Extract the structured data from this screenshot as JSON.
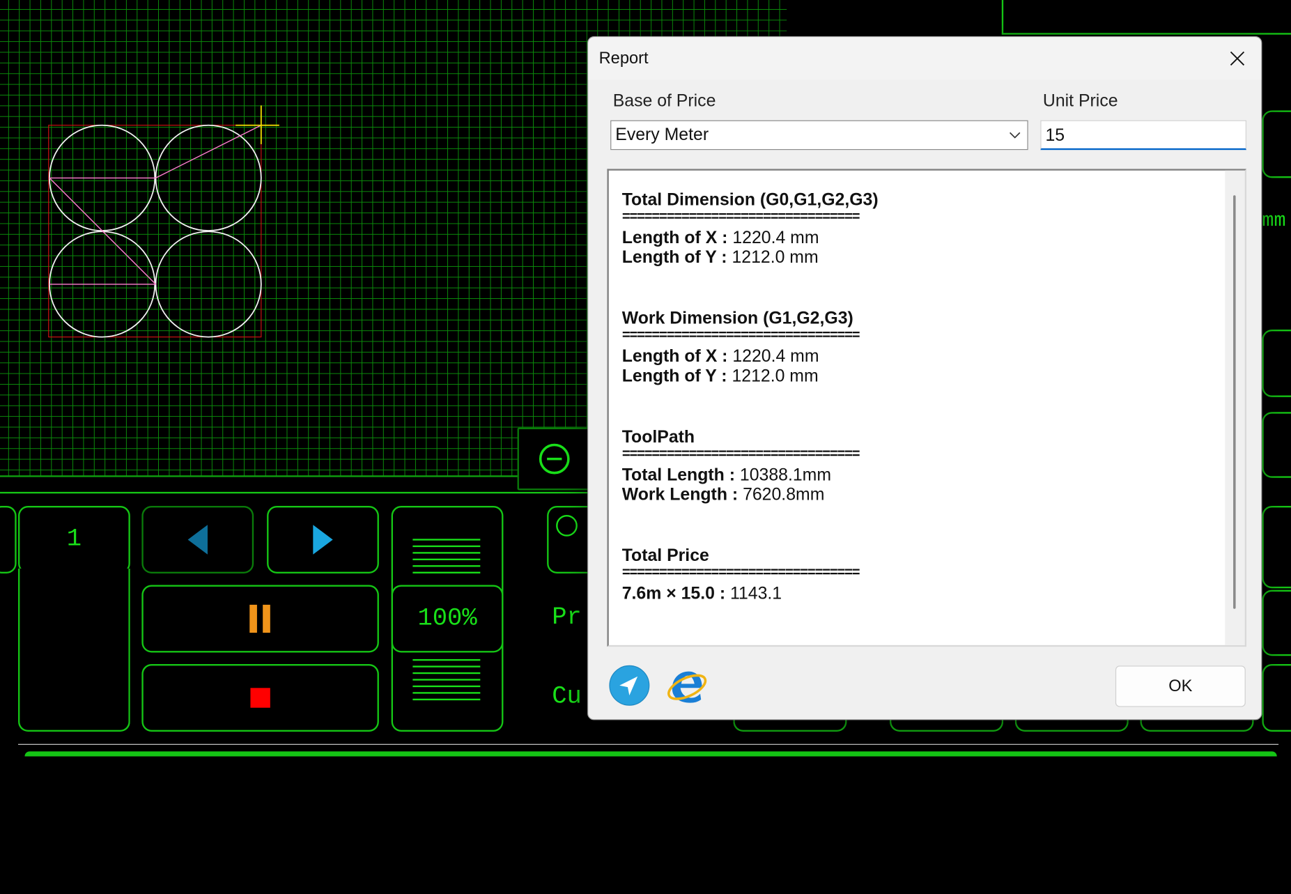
{
  "panel": {
    "counter_value": "1",
    "speed_value": "100%",
    "label_pr": "Pr",
    "label_cu": "Cu",
    "label_mm": "mm",
    "colors": {
      "accent": "#19e019",
      "nav_arrow": "#1aa7e0",
      "pause": "#f0941a",
      "stop": "#ff0000"
    }
  },
  "dialog": {
    "title": "Report",
    "base_label": "Base of Price",
    "base_value": "Every Meter",
    "unit_label": "Unit Price",
    "unit_value": "15",
    "ok_label": "OK",
    "report": {
      "separator": "================================",
      "sections": [
        {
          "title": "Total Dimension (G0,G1,G2,G3)",
          "rows": [
            {
              "key": "Length of X :",
              "value": "1220.4 mm"
            },
            {
              "key": "Length of Y :",
              "value": "1212.0 mm"
            }
          ]
        },
        {
          "title": "Work Dimension (G1,G2,G3)",
          "rows": [
            {
              "key": "Length of X :",
              "value": "1220.4 mm"
            },
            {
              "key": "Length of Y :",
              "value": "1212.0 mm"
            }
          ]
        },
        {
          "title": "ToolPath",
          "rows": [
            {
              "key": "Total Length :",
              "value": "10388.1mm"
            },
            {
              "key": "Work Length :",
              "value": "7620.8mm"
            }
          ]
        },
        {
          "title": "Total Price",
          "rows": [
            {
              "key": "7.6m × 15.0 :",
              "value": "1143.1"
            }
          ]
        }
      ]
    }
  }
}
